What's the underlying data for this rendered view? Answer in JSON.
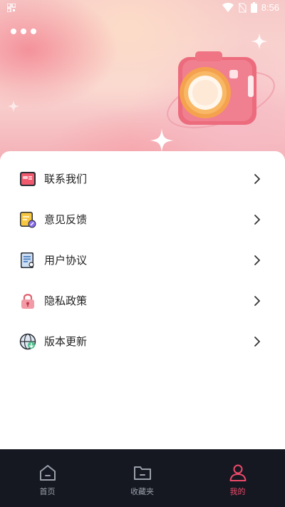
{
  "status_bar": {
    "time": "8:56",
    "icons": [
      "qr-icon",
      "wifi-icon",
      "no-sim-icon",
      "battery-icon"
    ]
  },
  "header": {
    "more_icon": "three-dots-icon",
    "illustration": "camera-illustration"
  },
  "menu": {
    "items": [
      {
        "label": "联系我们",
        "icon": "contact-card-icon"
      },
      {
        "label": "意见反馈",
        "icon": "feedback-note-icon"
      },
      {
        "label": "用户协议",
        "icon": "agreement-document-icon"
      },
      {
        "label": "隐私政策",
        "icon": "privacy-lock-icon"
      },
      {
        "label": "版本更新",
        "icon": "update-globe-icon"
      }
    ]
  },
  "tab_bar": {
    "tabs": [
      {
        "label": "首页",
        "icon": "home-icon",
        "active": false
      },
      {
        "label": "收藏夹",
        "icon": "folder-icon",
        "active": false
      },
      {
        "label": "我的",
        "icon": "user-icon",
        "active": true
      }
    ]
  },
  "colors": {
    "accent": "#ec4a6a",
    "tab_bar_bg": "#151821",
    "tab_inactive": "#9aa0aa"
  }
}
